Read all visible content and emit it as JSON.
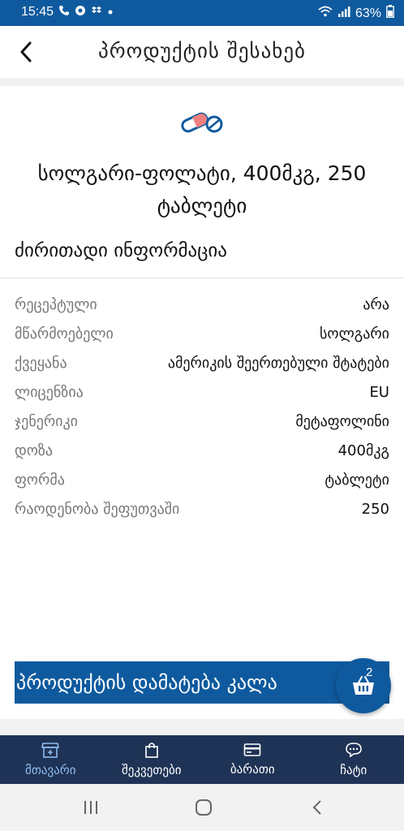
{
  "status_bar": {
    "time": "15:45",
    "battery": "63%",
    "icons": [
      "wifi-call-icon",
      "app-notification-icon",
      "dropbox-icon",
      "dot-icon",
      "wifi-icon",
      "signal-icon",
      "battery-icon"
    ]
  },
  "header": {
    "title": "პროდუქტის შესახებ",
    "back_icon": "back-arrow-icon"
  },
  "product": {
    "icon": "pills-icon",
    "title": "სოლგარი-ფოლატი, 400მკგ, 250 ტაბლეტი"
  },
  "info": {
    "section_title": "ძირითადი ინფორმაცია",
    "rows": [
      {
        "label": "რეცეპტული",
        "value": "არა"
      },
      {
        "label": "მწარმოებელი",
        "value": "სოლგარი"
      },
      {
        "label": "ქვეყანა",
        "value": "ამერიკის შეერთებული შტატები"
      },
      {
        "label": "ლიცენზია",
        "value": "EU"
      },
      {
        "label": "ჯენერიკი",
        "value": "მეტაფოლინი"
      },
      {
        "label": "დოზა",
        "value": "400მკგ"
      },
      {
        "label": "ფორმა",
        "value": "ტაბლეტი"
      },
      {
        "label": "რაოდენობა შეფუთვაში",
        "value": "250"
      }
    ]
  },
  "actions": {
    "add_to_cart": "პროდუქტის დამატება კალა",
    "cart_count": "2",
    "cart_icon": "basket-icon"
  },
  "bottom_nav": {
    "items": [
      {
        "label": "მთავარი",
        "icon": "store-icon",
        "active": true
      },
      {
        "label": "შეკვეთები",
        "icon": "bag-icon",
        "active": false
      },
      {
        "label": "ბარათი",
        "icon": "card-icon",
        "active": false
      },
      {
        "label": "ჩატი",
        "icon": "chat-icon",
        "active": false
      }
    ]
  },
  "colors": {
    "primary": "#0f5a9e",
    "nav_background": "#1f3356",
    "nav_active": "#8fbcf0"
  }
}
